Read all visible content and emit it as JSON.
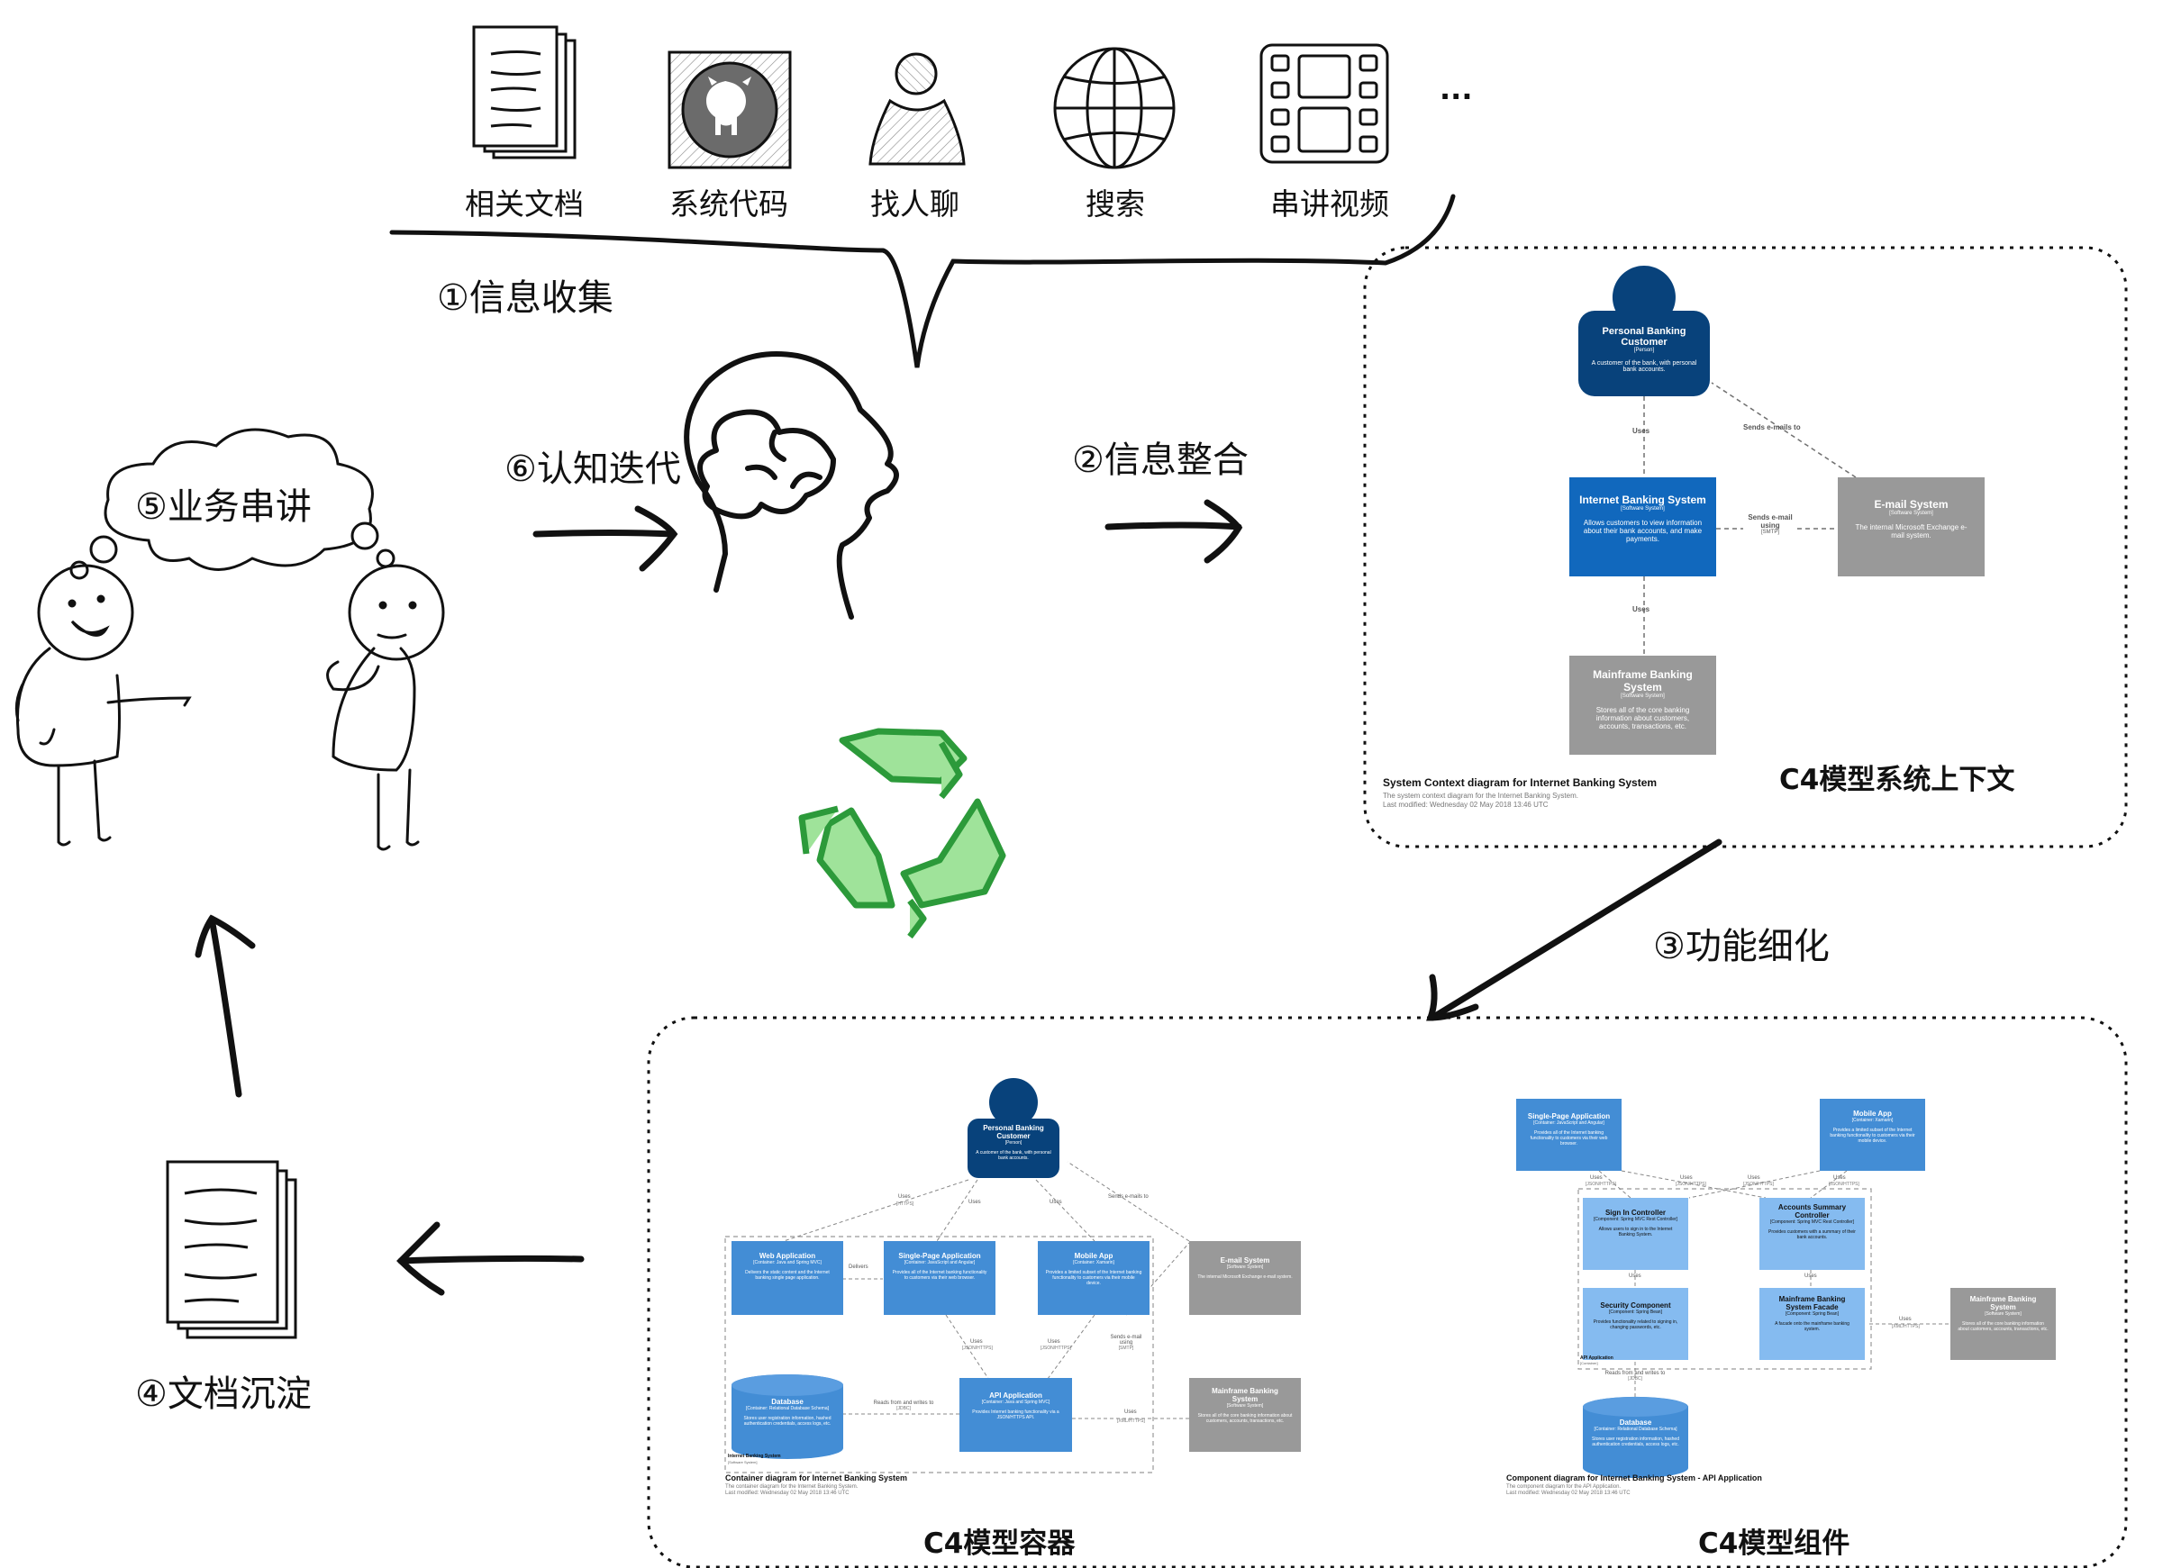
{
  "sources": [
    {
      "label": "相关文档",
      "icon": "document-stack-icon"
    },
    {
      "label": "系统代码",
      "icon": "github-icon"
    },
    {
      "label": "找人聊",
      "icon": "person-icon"
    },
    {
      "label": "搜索",
      "icon": "globe-icon"
    },
    {
      "label": "串讲视频",
      "icon": "film-icon"
    },
    {
      "label": "...",
      "icon": "ellipsis"
    }
  ],
  "steps": {
    "s1": "①信息收集",
    "s2": "②信息整合",
    "s3": "③功能细化",
    "s4": "④文档沉淀",
    "s5": "⑤业务串讲",
    "s6": "⑥认知迭代"
  },
  "context_diagram": {
    "caption": "C4模型系统上下文",
    "customer": {
      "title": "Personal Banking Customer",
      "type": "[Person]",
      "desc": "A customer of the bank, with personal bank accounts."
    },
    "ibs": {
      "title": "Internet Banking System",
      "type": "[Software System]",
      "desc": "Allows customers to view information about their bank accounts, and make payments."
    },
    "email": {
      "title": "E-mail System",
      "type": "[Software System]",
      "desc": "The internal Microsoft Exchange e-mail system."
    },
    "mainframe": {
      "title": "Mainframe Banking System",
      "type": "[Software System]",
      "desc": "Stores all of the core banking information about customers, accounts, transactions, etc."
    },
    "rel_uses_1": "Uses",
    "rel_uses_2": "Uses",
    "rel_sends_customer": "Sends e-mails to",
    "rel_sends_using": "Sends e-mail using",
    "rel_smtp": "[SMTP]",
    "footer_title": "System Context diagram for Internet Banking System",
    "footer_sub": "The system context diagram for the Internet Banking System.",
    "footer_date": "Last modified: Wednesday 02 May 2018 13:46 UTC"
  },
  "container_diagram": {
    "caption": "C4模型容器",
    "customer": {
      "title": "Personal Banking Customer",
      "type": "[Person]",
      "desc": "A customer of the bank, with personal bank accounts."
    },
    "webapp": {
      "title": "Web Application",
      "type": "[Container: Java and Spring MVC]",
      "desc": "Delivers the static content and the Internet banking single page application."
    },
    "spa": {
      "title": "Single-Page Application",
      "type": "[Container: JavaScript and Angular]",
      "desc": "Provides all of the Internet banking functionality to customers via their web browser."
    },
    "mobile": {
      "title": "Mobile App",
      "type": "[Container: Xamarin]",
      "desc": "Provides a limited subset of the Internet banking functionality to customers via their mobile device."
    },
    "email": {
      "title": "E-mail System",
      "type": "[Software System]",
      "desc": "The internal Microsoft Exchange e-mail system."
    },
    "api": {
      "title": "API Application",
      "type": "[Container: Java and Spring MVC]",
      "desc": "Provides Internet banking functionality via a JSON/HTTPS API."
    },
    "db": {
      "title": "Database",
      "type": "[Container: Relational Database Schema]",
      "desc": "Stores user registration information, hashed authentication credentials, access logs, etc."
    },
    "mainframe": {
      "title": "Mainframe Banking System",
      "type": "[Software System]",
      "desc": "Stores all of the core banking information about customers, accounts, transactions, etc."
    },
    "boundary_label": "Internet Banking System",
    "boundary_type": "[Software System]",
    "rel_uses_a": "Uses",
    "rel_uses_a_proto": "[HTTPS]",
    "rel_uses_b": "Uses",
    "rel_uses_c": "Uses",
    "rel_sends": "Sends e-mails to",
    "rel_delivers": "Delivers",
    "rel_uses_d": "Uses",
    "rel_uses_d_proto": "[JSON/HTTPS]",
    "rel_uses_e": "Uses",
    "rel_uses_e_proto": "[JSON/HTTPS]",
    "rel_sends_using": "Sends e-mail using",
    "rel_sends_proto": "[SMTP]",
    "rel_reads": "Reads from and writes to",
    "rel_reads_proto": "[JDBC]",
    "rel_uses_f": "Uses",
    "rel_uses_f_proto": "[XML/HTTPS]",
    "footer_title": "Container diagram for Internet Banking System",
    "footer_sub": "The container diagram for the Internet Banking System.",
    "footer_date": "Last modified: Wednesday 02 May 2018 13:46 UTC"
  },
  "component_diagram": {
    "caption": "C4模型组件",
    "spa": {
      "title": "Single-Page Application",
      "type": "[Container: JavaScript and Angular]",
      "desc": "Provides all of the Internet banking functionality to customers via their web browser."
    },
    "mobile": {
      "title": "Mobile App",
      "type": "[Container: Xamarin]",
      "desc": "Provides a limited subset of the Internet banking functionality to customers via their mobile device."
    },
    "signin": {
      "title": "Sign In Controller",
      "type": "[Component: Spring MVC Rest Controller]",
      "desc": "Allows users to sign in to the Internet Banking System."
    },
    "accounts": {
      "title": "Accounts Summary Controller",
      "type": "[Component: Spring MVC Rest Controller]",
      "desc": "Provides customers with a summary of their bank accounts."
    },
    "security": {
      "title": "Security Component",
      "type": "[Component: Spring Bean]",
      "desc": "Provides functionality related to signing in, changing passwords, etc."
    },
    "facade": {
      "title": "Mainframe Banking System Facade",
      "type": "[Component: Spring Bean]",
      "desc": "A facade onto the mainframe banking system."
    },
    "mainframe": {
      "title": "Mainframe Banking System",
      "type": "[Software System]",
      "desc": "Stores all of the core banking information about customers, accounts, transactions, etc."
    },
    "db": {
      "title": "Database",
      "type": "[Container: Relational Database Schema]",
      "desc": "Stores user registration information, hashed authentication credentials, access logs, etc."
    },
    "boundary_label": "API Application",
    "boundary_type": "[Container]",
    "rel_uses_1": "Uses",
    "rel_uses_1_proto": "[JSON/HTTPS]",
    "rel_uses_2": "Uses",
    "rel_uses_2_proto": "[JSON/HTTPS]",
    "rel_uses_3": "Uses",
    "rel_uses_3_proto": "[JSON/HTTPS]",
    "rel_uses_4": "Uses",
    "rel_uses_4_proto": "[JSON/HTTPS]",
    "rel_uses_5": "Uses",
    "rel_uses_6": "Uses",
    "rel_uses_7": "Uses",
    "rel_uses_7_proto": "[XML/HTTPS]",
    "rel_reads": "Reads from and writes to",
    "rel_reads_proto": "[JDBC]",
    "footer_title": "Component diagram for Internet Banking System - API Application",
    "footer_sub": "The component diagram for the API Application.",
    "footer_date": "Last modified: Wednesday 02 May 2018 13:46 UTC"
  },
  "colors": {
    "person": "#08427b",
    "container": "#438dd5",
    "component": "#85bbf0",
    "system": "#1168bd",
    "external": "#999999",
    "recycle": "#47b34a",
    "ink": "#111111"
  }
}
